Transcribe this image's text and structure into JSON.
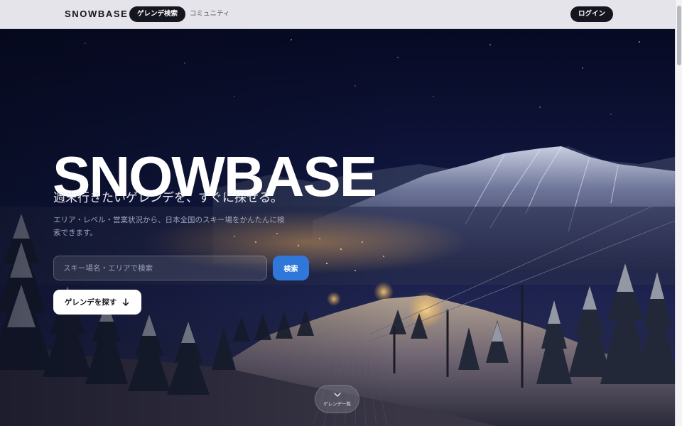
{
  "header": {
    "brand": "SNOWBASE",
    "nav": [
      {
        "label": "ゲレンデ検索",
        "active": true
      },
      {
        "label": "コミュニティ",
        "active": false
      }
    ],
    "login_label": "ログイン"
  },
  "hero": {
    "title": "SNOWBASE",
    "tagline": "週末行きたいゲレンデを、すぐに探せる。",
    "description": "エリア・レベル・営業状況から、日本全国のスキー場をかんたんに検索できます。",
    "background": "night ski resort with snowy mountains, lit slopes and ski lift"
  },
  "search": {
    "placeholder": "スキー場名・エリアで検索",
    "value": "",
    "button_label": "検索"
  },
  "cta": {
    "label": "ゲレンデを探す",
    "icon": "arrow-down-icon"
  },
  "scroll_cue": {
    "label": "ゲレンデ一覧",
    "icon": "chevron-down-icon"
  },
  "colors": {
    "header_bg": "#e4e4ea",
    "primary_dark": "#14151f",
    "accent_blue": "#2f78d9",
    "hero_sky": "#0b1030"
  }
}
